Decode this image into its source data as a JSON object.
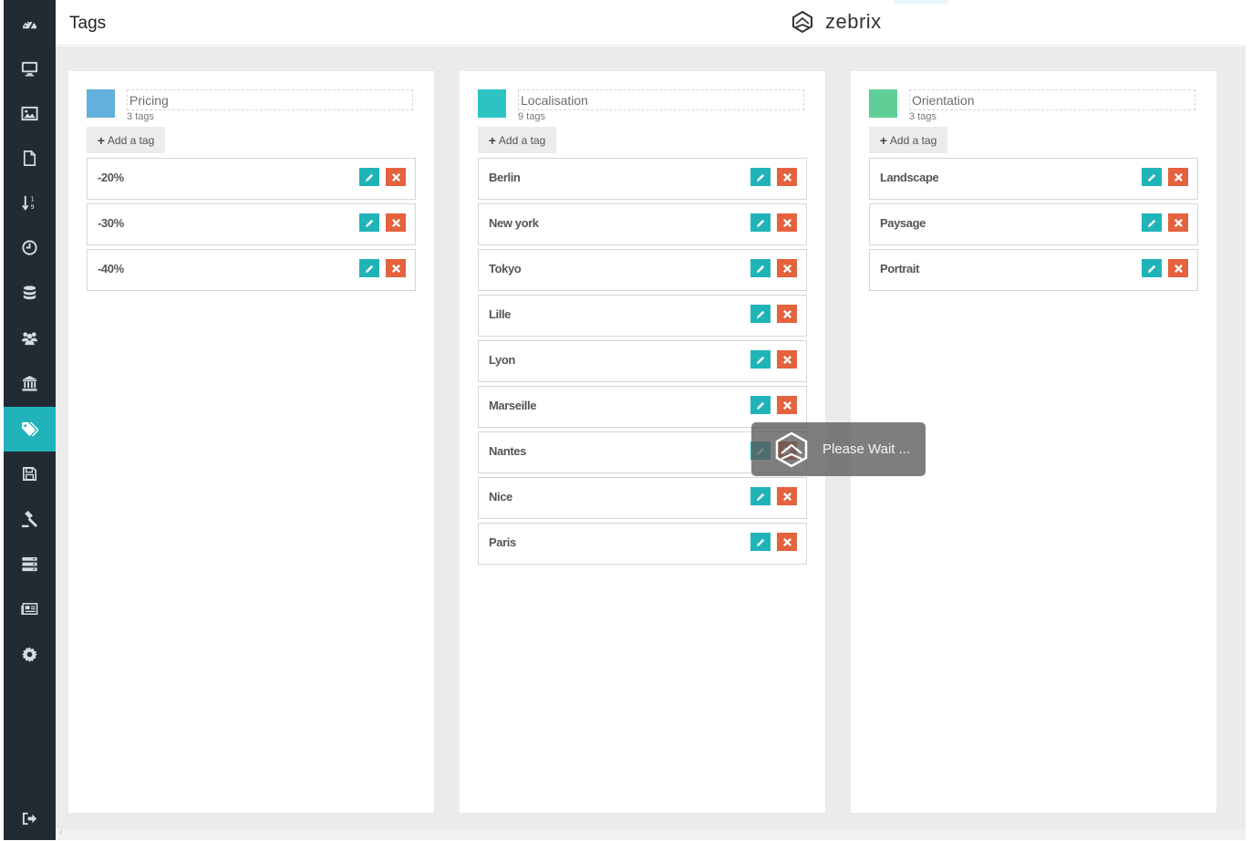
{
  "page": {
    "title": "Tags"
  },
  "brand": {
    "name": "zebrix"
  },
  "sidebar": {
    "items": [
      {
        "icon": "dashboard-icon",
        "active": false
      },
      {
        "icon": "monitor-icon",
        "active": false
      },
      {
        "icon": "image-icon",
        "active": false
      },
      {
        "icon": "file-icon",
        "active": false
      },
      {
        "icon": "sort-numeric-icon",
        "active": false
      },
      {
        "icon": "clock-icon",
        "active": false
      },
      {
        "icon": "database-icon",
        "active": false
      },
      {
        "icon": "users-icon",
        "active": false
      },
      {
        "icon": "bank-icon",
        "active": false
      },
      {
        "icon": "tags-icon",
        "active": true
      },
      {
        "icon": "save-icon",
        "active": false
      },
      {
        "icon": "gavel-icon",
        "active": false
      },
      {
        "icon": "server-icon",
        "active": false
      },
      {
        "icon": "newspaper-icon",
        "active": false
      },
      {
        "icon": "gear-icon",
        "active": false
      }
    ],
    "logout_icon": "sign-out-icon"
  },
  "groups": [
    {
      "name": "Pricing",
      "count": "3 tags",
      "color": "#64b0dc",
      "add_label": "Add a tag",
      "tags": [
        "-20%",
        "-30%",
        "-40%"
      ]
    },
    {
      "name": "Localisation",
      "count": "9 tags",
      "color": "#2dc3c4",
      "add_label": "Add a tag",
      "tags": [
        "Berlin",
        "New york",
        "Tokyo",
        "Lille",
        "Lyon",
        "Marseille",
        "Nantes",
        "Nice",
        "Paris"
      ]
    },
    {
      "name": "Orientation",
      "count": "3 tags",
      "color": "#5fcf97",
      "add_label": "Add a tag",
      "tags": [
        "Landscape",
        "Paysage",
        "Portrait"
      ]
    }
  ],
  "overlay": {
    "text": "Please Wait ..."
  },
  "colors": {
    "accent": "#1fb3b9",
    "edit": "#20b4b9",
    "delete": "#e4623e",
    "sidebar": "#222b33"
  }
}
